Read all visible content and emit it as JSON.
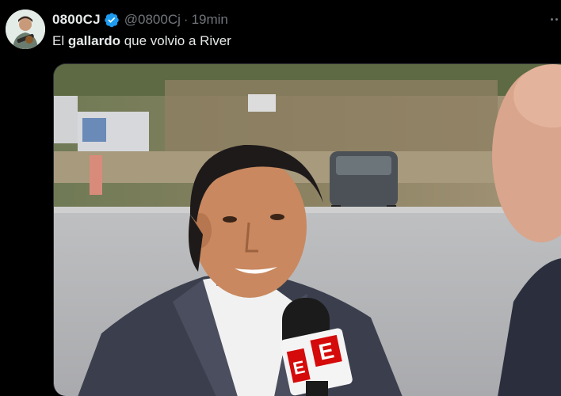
{
  "author": {
    "display_name": "0800CJ",
    "handle": "@0800Cj",
    "separator": "·",
    "time": "19min",
    "verified": true,
    "verified_color": "#1d9bf0"
  },
  "tweet": {
    "text_before": "El ",
    "text_bold": "gallardo",
    "text_after": " que volvio a River"
  },
  "media": {
    "mic_flag_letters": [
      "E",
      "E"
    ],
    "mic_flag_color": "#d50a0a"
  },
  "icons": [
    "verified-badge-icon",
    "more-options-icon"
  ]
}
